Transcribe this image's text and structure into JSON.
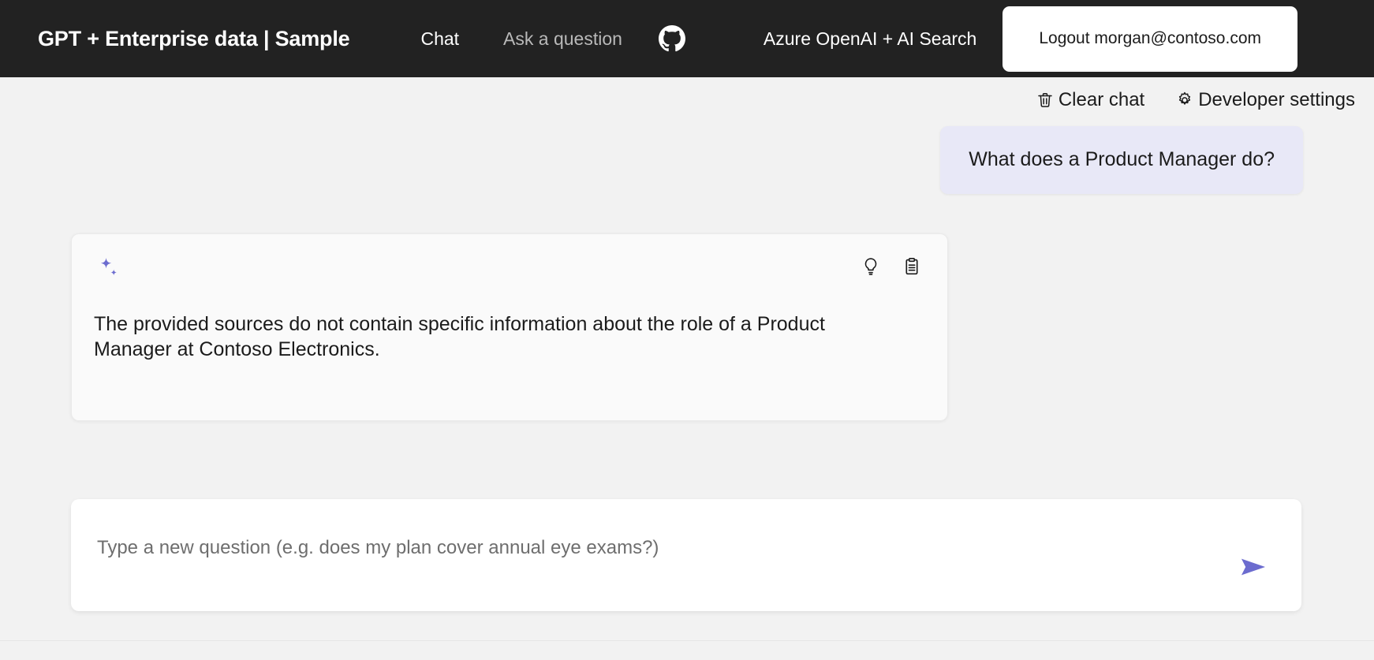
{
  "header": {
    "title": "GPT + Enterprise data | Sample",
    "nav": [
      {
        "label": "Chat",
        "active": true,
        "name": "nav-chat"
      },
      {
        "label": "Ask a question",
        "active": false,
        "name": "nav-ask-a-question"
      }
    ],
    "github_icon": "github-icon",
    "subtitle": "Azure OpenAI + AI Search",
    "logout_label": "Logout morgan@contoso.com"
  },
  "commands": {
    "clear_chat": {
      "label": "Clear chat",
      "icon": "trash-icon"
    },
    "developer_settings": {
      "label": "Developer settings",
      "icon": "gear-icon"
    }
  },
  "chat": {
    "user_message": "What does a Product Manager do?",
    "answer": {
      "sparkle_icon": "sparkle-icon",
      "text": "The provided sources do not contain specific information about the role of a Product Manager at Contoso Electronics.",
      "actions": [
        {
          "name": "show-thought-process-button",
          "icon": "lightbulb-icon"
        },
        {
          "name": "show-supporting-content-button",
          "icon": "clipboard-list-icon"
        }
      ]
    }
  },
  "input": {
    "placeholder": "Type a new question (e.g. does my plan cover annual eye exams?)",
    "value": "",
    "send_icon": "send-arrow-icon"
  },
  "colors": {
    "header_bg": "#222222",
    "page_bg": "#f2f2f2",
    "accent": "#6c6ccf",
    "user_bubble_bg": "#e8e8f7",
    "answer_card_bg": "#fafafa",
    "text": "#1b1b1b"
  }
}
